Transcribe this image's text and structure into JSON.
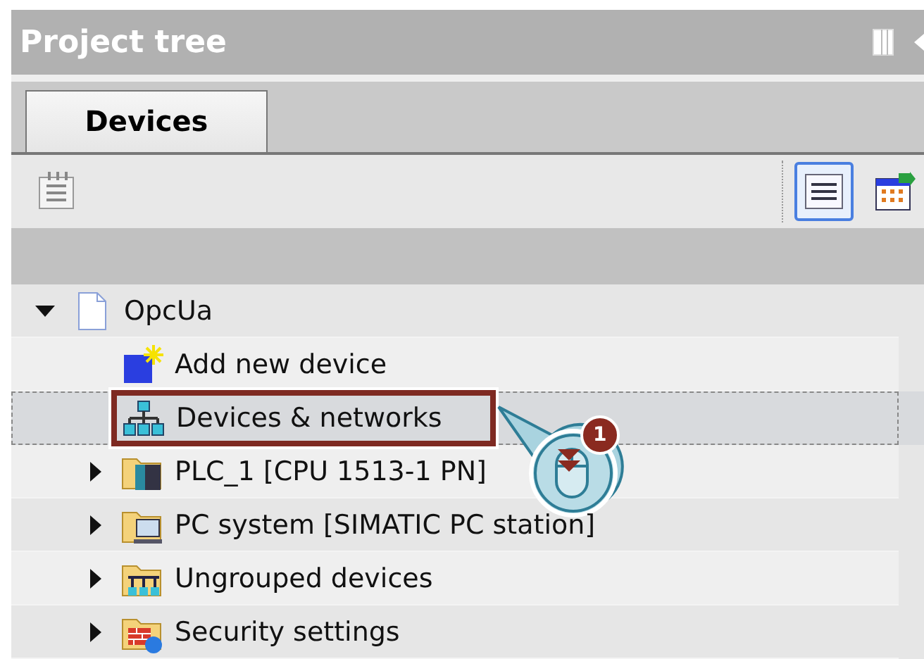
{
  "panel": {
    "title": "Project tree"
  },
  "tabs": [
    {
      "label": "Devices",
      "selected": true
    }
  ],
  "tree": [
    {
      "label": "OpcUa",
      "kind": "project",
      "expanded": true,
      "selected": false,
      "highlighted": false,
      "children": [
        {
          "label": "Add new device",
          "kind": "add-device",
          "selected": false,
          "highlighted": false
        },
        {
          "label": "Devices & networks",
          "kind": "network-view",
          "selected": true,
          "highlighted": true
        },
        {
          "label": "PLC_1 [CPU 1513-1 PN]",
          "kind": "plc-folder",
          "expanded": false,
          "selected": false,
          "highlighted": false
        },
        {
          "label": "PC system [SIMATIC PC station]",
          "kind": "pc-folder",
          "expanded": false,
          "selected": false,
          "highlighted": false
        },
        {
          "label": "Ungrouped devices",
          "kind": "ungrouped-folder",
          "expanded": false,
          "selected": false,
          "highlighted": false
        },
        {
          "label": "Security settings",
          "kind": "security-folder",
          "expanded": false,
          "selected": false,
          "highlighted": false
        }
      ]
    }
  ],
  "callout": {
    "step": "1"
  }
}
